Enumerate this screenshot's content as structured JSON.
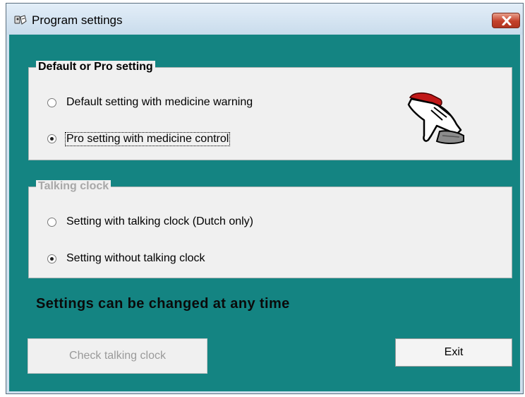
{
  "window": {
    "title": "Program settings"
  },
  "groups": {
    "mode": {
      "legend": "Default or Pro setting",
      "options": [
        {
          "label": "Default setting with medicine warning",
          "checked": false
        },
        {
          "label": "Pro setting with medicine control",
          "checked": true
        }
      ]
    },
    "clock": {
      "legend": "Talking clock",
      "options": [
        {
          "label": "Setting with talking clock (Dutch only)",
          "checked": false
        },
        {
          "label": "Setting without talking clock",
          "checked": true
        }
      ]
    }
  },
  "info": "Settings can be changed at any time",
  "buttons": {
    "check_clock": "Check talking clock",
    "exit": "Exit"
  },
  "icons": {
    "app": "app-icon",
    "close": "close-icon",
    "hand": "hand-pointer-icon"
  },
  "colors": {
    "background": "#148482",
    "close_button": "#c4412b"
  }
}
